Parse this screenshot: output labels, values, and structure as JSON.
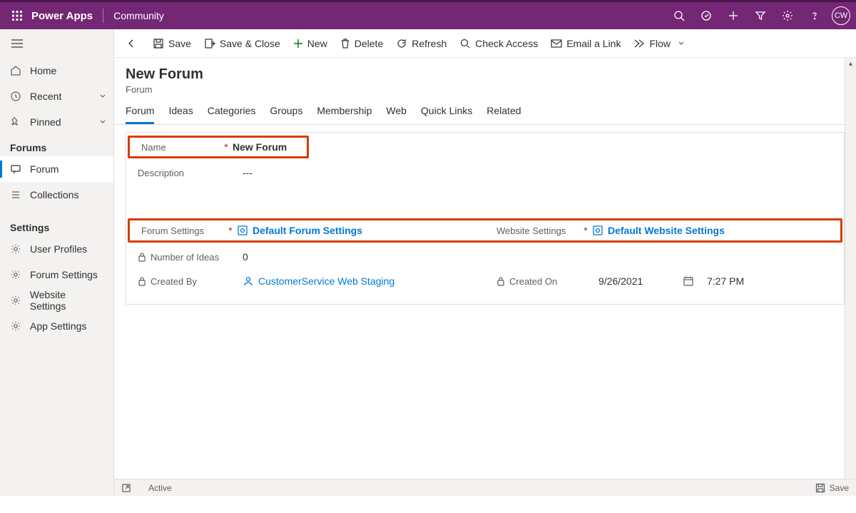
{
  "header": {
    "app_name": "Power Apps",
    "sub_name": "Community",
    "avatar": "CW"
  },
  "commands": {
    "save": "Save",
    "save_close": "Save & Close",
    "new": "New",
    "delete": "Delete",
    "refresh": "Refresh",
    "check_access": "Check Access",
    "email_link": "Email a Link",
    "flow": "Flow"
  },
  "side_nav": {
    "home": "Home",
    "recent": "Recent",
    "pinned": "Pinned",
    "section_forums": "Forums",
    "forum": "Forum",
    "collections": "Collections",
    "section_settings": "Settings",
    "user_profiles": "User Profiles",
    "forum_settings": "Forum Settings",
    "website_settings": "Website Settings",
    "app_settings": "App Settings"
  },
  "page": {
    "title": "New Forum",
    "entity": "Forum"
  },
  "tabs": {
    "forum": "Forum",
    "ideas": "Ideas",
    "categories": "Categories",
    "groups": "Groups",
    "membership": "Membership",
    "web": "Web",
    "quick_links": "Quick Links",
    "related": "Related"
  },
  "form": {
    "name_label": "Name",
    "name_value": "New Forum",
    "description_label": "Description",
    "description_value": "---",
    "forum_settings_label": "Forum Settings",
    "forum_settings_value": "Default Forum Settings",
    "website_settings_label": "Website Settings",
    "website_settings_value": "Default Website Settings",
    "num_ideas_label": "Number of Ideas",
    "num_ideas_value": "0",
    "created_by_label": "Created By",
    "created_by_value": "CustomerService Web Staging",
    "created_on_label": "Created On",
    "created_on_date": "9/26/2021",
    "created_on_time": "7:27 PM"
  },
  "status": {
    "state": "Active",
    "save": "Save"
  }
}
